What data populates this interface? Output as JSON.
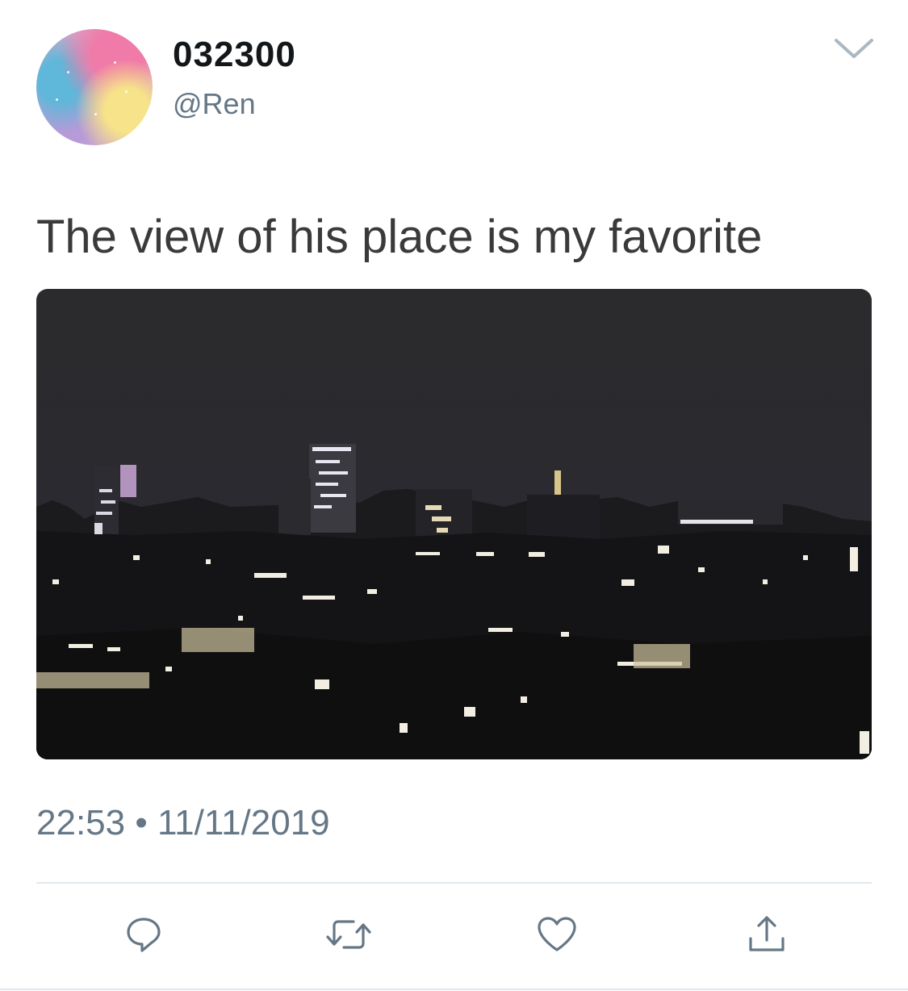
{
  "tweet": {
    "display_name": "032300",
    "handle": "@Ren",
    "text": "The view of his place is my favorite",
    "timestamp": "22:53 • 11/11/2019"
  },
  "icons": {
    "menu": "chevron-down-icon",
    "reply": "reply-icon",
    "retweet": "retweet-icon",
    "like": "heart-icon",
    "share": "share-icon"
  },
  "colors": {
    "text_primary": "#14171a",
    "text_secondary": "#657786",
    "divider": "#e1e8ed",
    "icon_gray": "#657786"
  }
}
